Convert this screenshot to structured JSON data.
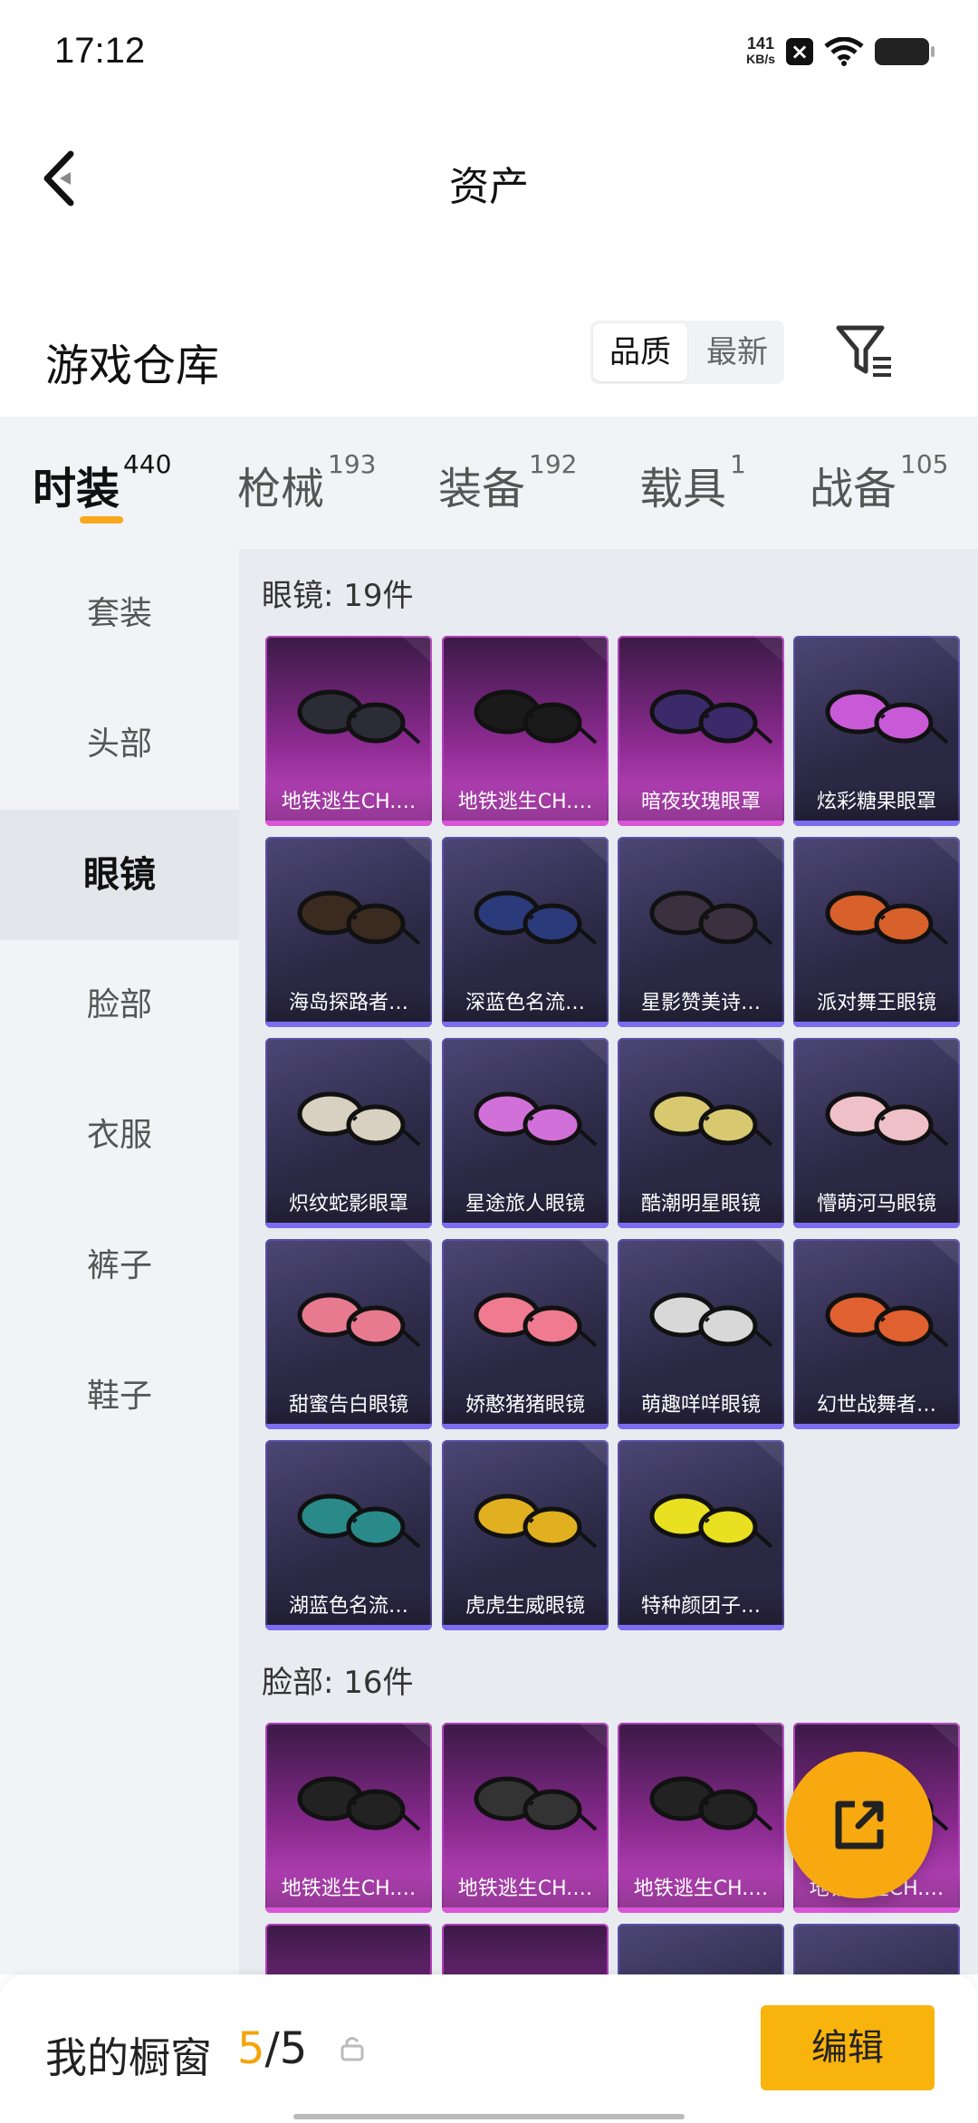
{
  "status": {
    "time": "17:12",
    "net_value": "141",
    "net_unit": "KB/s"
  },
  "nav": {
    "title": "资产"
  },
  "warehouse": {
    "title": "游戏仓库",
    "sort_quality": "品质",
    "sort_newest": "最新"
  },
  "tabs": [
    {
      "label": "时装",
      "count": "440"
    },
    {
      "label": "枪械",
      "count": "193"
    },
    {
      "label": "装备",
      "count": "192"
    },
    {
      "label": "载具",
      "count": "1"
    },
    {
      "label": "战备",
      "count": "105"
    }
  ],
  "sidebar": [
    {
      "label": "套装"
    },
    {
      "label": "头部"
    },
    {
      "label": "眼镜"
    },
    {
      "label": "脸部"
    },
    {
      "label": "衣服"
    },
    {
      "label": "裤子"
    },
    {
      "label": "鞋子"
    }
  ],
  "sections": [
    {
      "title": "眼镜: 19件",
      "items": [
        {
          "name": "地铁逃生CH.…",
          "rarity": "pink",
          "icon": "goggles"
        },
        {
          "name": "地铁逃生CH.…",
          "rarity": "pink",
          "icon": "goggles-dark"
        },
        {
          "name": "暗夜玫瑰眼罩",
          "rarity": "pink",
          "icon": "rose-mask"
        },
        {
          "name": "炫彩糖果眼罩",
          "rarity": "purple",
          "icon": "candy-mask"
        },
        {
          "name": "海岛探路者…",
          "rarity": "purple",
          "icon": "sunglasses"
        },
        {
          "name": "深蓝色名流…",
          "rarity": "purple",
          "icon": "sunglasses-blue"
        },
        {
          "name": "星影赞美诗…",
          "rarity": "purple",
          "icon": "veil"
        },
        {
          "name": "派对舞王眼镜",
          "rarity": "purple",
          "icon": "sunglasses-orange"
        },
        {
          "name": "炽纹蛇影眼罩",
          "rarity": "purple",
          "icon": "snake-mask"
        },
        {
          "name": "星途旅人眼镜",
          "rarity": "purple",
          "icon": "visor-pink"
        },
        {
          "name": "酷潮明星眼镜",
          "rarity": "purple",
          "icon": "aviator-gold"
        },
        {
          "name": "懵萌河马眼镜",
          "rarity": "purple",
          "icon": "heart-glasses"
        },
        {
          "name": "甜蜜告白眼镜",
          "rarity": "purple",
          "icon": "pink-glasses"
        },
        {
          "name": "娇憨猪猪眼镜",
          "rarity": "purple",
          "icon": "round-pink"
        },
        {
          "name": "萌趣咩咩眼镜",
          "rarity": "purple",
          "icon": "round-white"
        },
        {
          "name": "幻世战舞者…",
          "rarity": "purple",
          "icon": "sunglasses-neon"
        },
        {
          "name": "湖蓝色名流…",
          "rarity": "purple",
          "icon": "sunglasses-teal"
        },
        {
          "name": "虎虎生威眼镜",
          "rarity": "purple",
          "icon": "ski-goggles"
        },
        {
          "name": "特种颜团子…",
          "rarity": "purple",
          "icon": "round-yellow"
        }
      ]
    },
    {
      "title": "脸部: 16件",
      "items": [
        {
          "name": "地铁逃生CH.…",
          "rarity": "pink",
          "icon": "balaclava"
        },
        {
          "name": "地铁逃生CH.…",
          "rarity": "pink",
          "icon": "gas-mask"
        },
        {
          "name": "地铁逃生CH.…",
          "rarity": "pink",
          "icon": "face-mask"
        },
        {
          "name": "地铁逃生CH.…",
          "rarity": "pink",
          "icon": "mask"
        }
      ]
    }
  ],
  "bottom": {
    "title": "我的橱窗",
    "count_current": "5",
    "count_sep": "/",
    "count_total": "5",
    "edit_label": "编辑"
  },
  "colors": {
    "accent": "#f8b30c",
    "pink_rarity": "#b23fbb",
    "purple_rarity": "#5a4fa8"
  }
}
